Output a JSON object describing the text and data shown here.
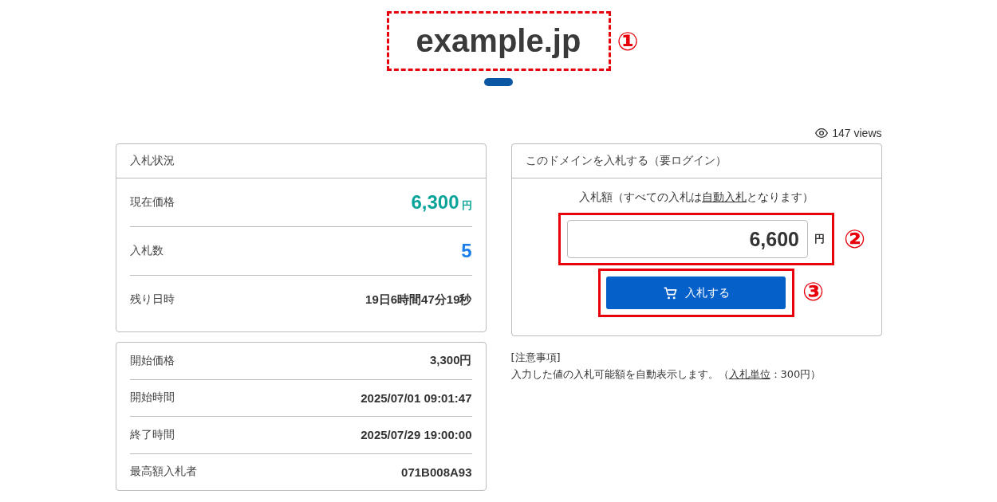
{
  "site": {
    "title": "example.jp"
  },
  "annotations": [
    {
      "label": "①"
    },
    {
      "label": "②"
    },
    {
      "label": "③"
    }
  ],
  "views": "147 views",
  "status_card": {
    "title": "入札状況",
    "rows": [
      {
        "kind": "price",
        "label": "現在価格",
        "value": "6,300",
        "unit": "円"
      },
      {
        "kind": "count",
        "label": "入札数",
        "value": "5"
      },
      {
        "kind": "text",
        "label": "残り日時",
        "value": "19日6時間47分19秒"
      }
    ]
  },
  "details": [
    {
      "label": "開始価格",
      "value": "3,300円"
    },
    {
      "label": "開始時間",
      "value": "2025/07/01 09:01:47"
    },
    {
      "label": "終了時間",
      "value": "2025/07/29 19:00:00"
    },
    {
      "label": "最高額入札者",
      "value": "071B008A93"
    }
  ],
  "bid_card": {
    "title": "このドメインを入札する（要ログイン）",
    "prompt": {
      "before": "入札額（すべての入札は",
      "link": "自動入札",
      "after": "となります）"
    },
    "amount": "6,600",
    "unit": "円",
    "button": "入札する"
  },
  "notes": {
    "heading": "[注意事項]",
    "text": {
      "before": "入力した値の入札可能額を自動表示します。（",
      "link": "入札単位",
      "after": "：300円）"
    }
  }
}
